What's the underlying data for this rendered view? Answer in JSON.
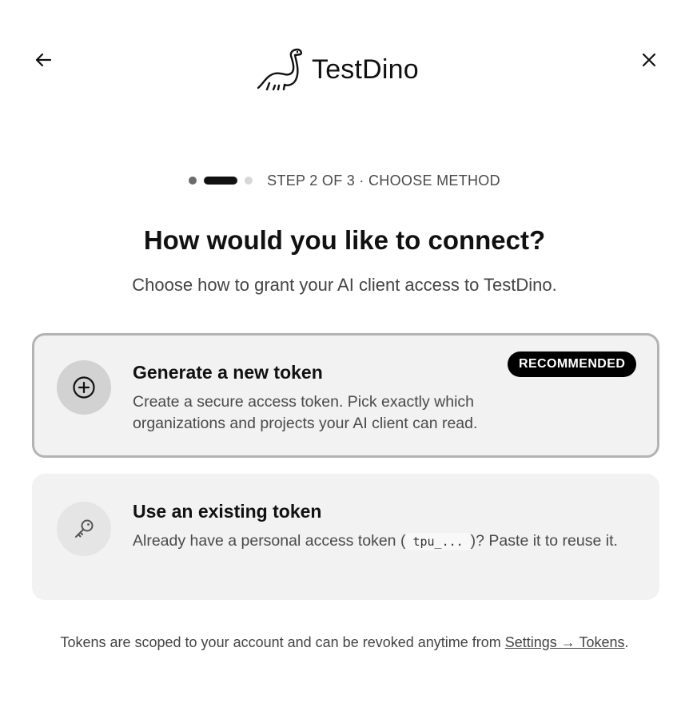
{
  "header": {
    "back_icon": "arrow-left-icon",
    "close_icon": "close-icon",
    "logo_icon": "dinosaur-logo",
    "logo_text": "TestDino"
  },
  "stepper": {
    "current_step": 2,
    "total_steps": 3,
    "label": "STEP 2 OF 3 · CHOOSE METHOD"
  },
  "title": "How would you like to connect?",
  "subtitle": "Choose how to grant your AI client access to TestDino.",
  "options": [
    {
      "icon": "plus-circle-icon",
      "title": "Generate a new token",
      "description": "Create a secure access token. Pick exactly which organizations and projects your AI client can read.",
      "badge": "RECOMMENDED",
      "selected": true
    },
    {
      "icon": "key-icon",
      "title": "Use an existing token",
      "description_before": "Already have a personal access token (",
      "code": "tpu_...",
      "description_after": ")? Paste it to reuse it.",
      "selected": false
    }
  ],
  "footer": {
    "text": "Tokens are scoped to your account and can be revoked anytime from ",
    "link": "Settings → Tokens",
    "end": "."
  },
  "colors": {
    "text": "#111111",
    "muted": "#444444",
    "card_bg": "#f2f2f2",
    "selected_border": "#b3b3b3",
    "badge_bg": "#000000"
  }
}
